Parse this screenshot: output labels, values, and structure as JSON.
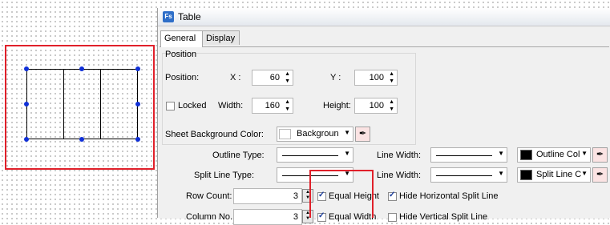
{
  "window": {
    "title": "Table",
    "icon": "Fs"
  },
  "tabs": [
    {
      "label": "General"
    },
    {
      "label": "Display"
    }
  ],
  "position_group": {
    "title": "Position",
    "position_label": "Position:",
    "x_label": "X :",
    "x_value": "60",
    "y_label": "Y :",
    "y_value": "100",
    "locked_label": "Locked",
    "locked_checked": false,
    "width_label": "Width:",
    "width_value": "160",
    "height_label": "Height:",
    "height_value": "100"
  },
  "sheet_bg": {
    "label": "Sheet Background Color:",
    "value": "Backgroun"
  },
  "outline": {
    "label": "Outline Type:",
    "line_width_label": "Line Width:",
    "color_label": "Outline Col"
  },
  "split_line": {
    "label": "Split Line Type:",
    "line_width_label": "Line Width:",
    "color_label": "Split Line C"
  },
  "row_count": {
    "label": "Row Count:",
    "value": "3"
  },
  "column_no": {
    "label": "Column No.:",
    "value": "3"
  },
  "options": {
    "equal_height": {
      "label": "Equal Height",
      "checked": true
    },
    "hide_horizontal": {
      "label": "Hide Horizontal Split Line",
      "checked": true
    },
    "equal_width": {
      "label": "Equal Width",
      "checked": true
    },
    "hide_vertical": {
      "label": "Hide Vertical Split Line",
      "checked": false
    }
  },
  "colors": {
    "selection_outline": "#e0202a",
    "handle": "#1030d8",
    "swatch_black": "#000000"
  }
}
